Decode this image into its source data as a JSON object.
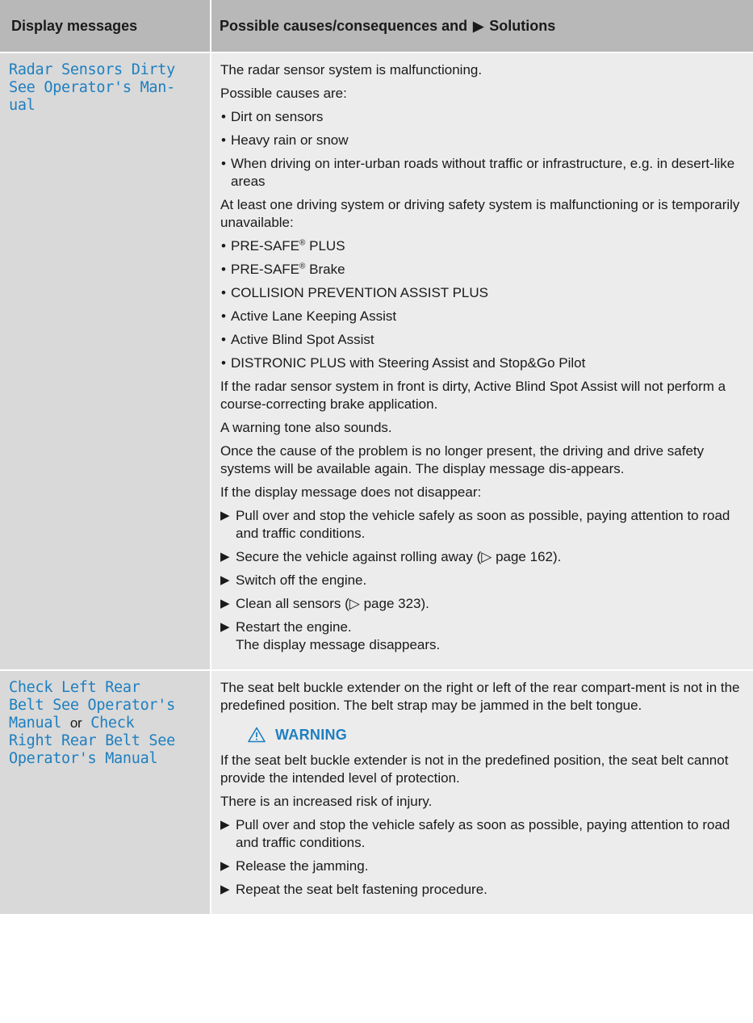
{
  "header": {
    "col1": "Display messages",
    "col2_prefix": "Possible causes/consequences and",
    "col2_suffix": "Solutions"
  },
  "row1": {
    "message": "Radar Sensors Dirty See Operator's Man-ual",
    "message_lines": [
      "Radar Sensors Dirty",
      "See Operator's Man-",
      "ual"
    ],
    "p1": "The radar sensor system is malfunctioning.",
    "p2": "Possible causes are:",
    "causes": [
      "Dirt on sensors",
      "Heavy rain or snow",
      "When driving on inter-urban roads without traffic or infrastructure, e.g. in desert-like areas"
    ],
    "p3": "At least one driving system or driving safety system is malfunctioning or is temporarily unavailable:",
    "systems": [
      {
        "pre": "PRE-SAFE",
        "reg": "®",
        "post": " PLUS"
      },
      {
        "pre": "PRE-SAFE",
        "reg": "®",
        "post": " Brake"
      },
      {
        "pre": "COLLISION PREVENTION ASSIST PLUS",
        "reg": "",
        "post": ""
      },
      {
        "pre": "Active Lane Keeping Assist",
        "reg": "",
        "post": ""
      },
      {
        "pre": "Active Blind Spot Assist",
        "reg": "",
        "post": ""
      },
      {
        "pre": "DISTRONIC PLUS with Steering Assist and Stop&Go Pilot",
        "reg": "",
        "post": ""
      }
    ],
    "p4": "If the radar sensor system in front is dirty, Active Blind Spot Assist will not perform a course-correcting brake application.",
    "p5": "A warning tone also sounds.",
    "p6": "Once the cause of the problem is no longer present, the driving and drive safety systems will be available again. The display message dis-appears.",
    "p7": "If the display message does not disappear:",
    "steps": [
      {
        "text": "Pull over and stop the vehicle safely as soon as possible, paying attention to road and traffic conditions.",
        "sub": ""
      },
      {
        "text": "Secure the vehicle against rolling away (▷ page 162).",
        "sub": ""
      },
      {
        "text": "Switch off the engine.",
        "sub": ""
      },
      {
        "text": "Clean all sensors (▷ page 323).",
        "sub": ""
      },
      {
        "text": "Restart the engine.",
        "sub": "The display message disappears."
      }
    ]
  },
  "row2": {
    "msg_a_lines": [
      "Check Left Rear",
      "Belt See Operator's",
      "Manual"
    ],
    "or_word": "or",
    "msg_b_first": "Check",
    "msg_b_lines": [
      "Right Rear Belt See",
      "Operator's Manual"
    ],
    "p1": "The seat belt buckle extender on the right or left of the rear compart-ment is not in the predefined position. The belt strap may be jammed in the belt tongue.",
    "warning_label": "WARNING",
    "p2": "If the seat belt buckle extender is not in the predefined position, the seat belt cannot provide the intended level of protection.",
    "p3": "There is an increased risk of injury.",
    "steps": [
      "Pull over and stop the vehicle safely as soon as possible, paying attention to road and traffic conditions.",
      "Release the jamming.",
      "Repeat the seat belt fastening procedure."
    ]
  },
  "colors": {
    "header_bg": "#b8b8b8",
    "left_col_bg": "#d9d9d9",
    "right_col_bg": "#ececec",
    "message_blue": "#1e7fc0"
  }
}
